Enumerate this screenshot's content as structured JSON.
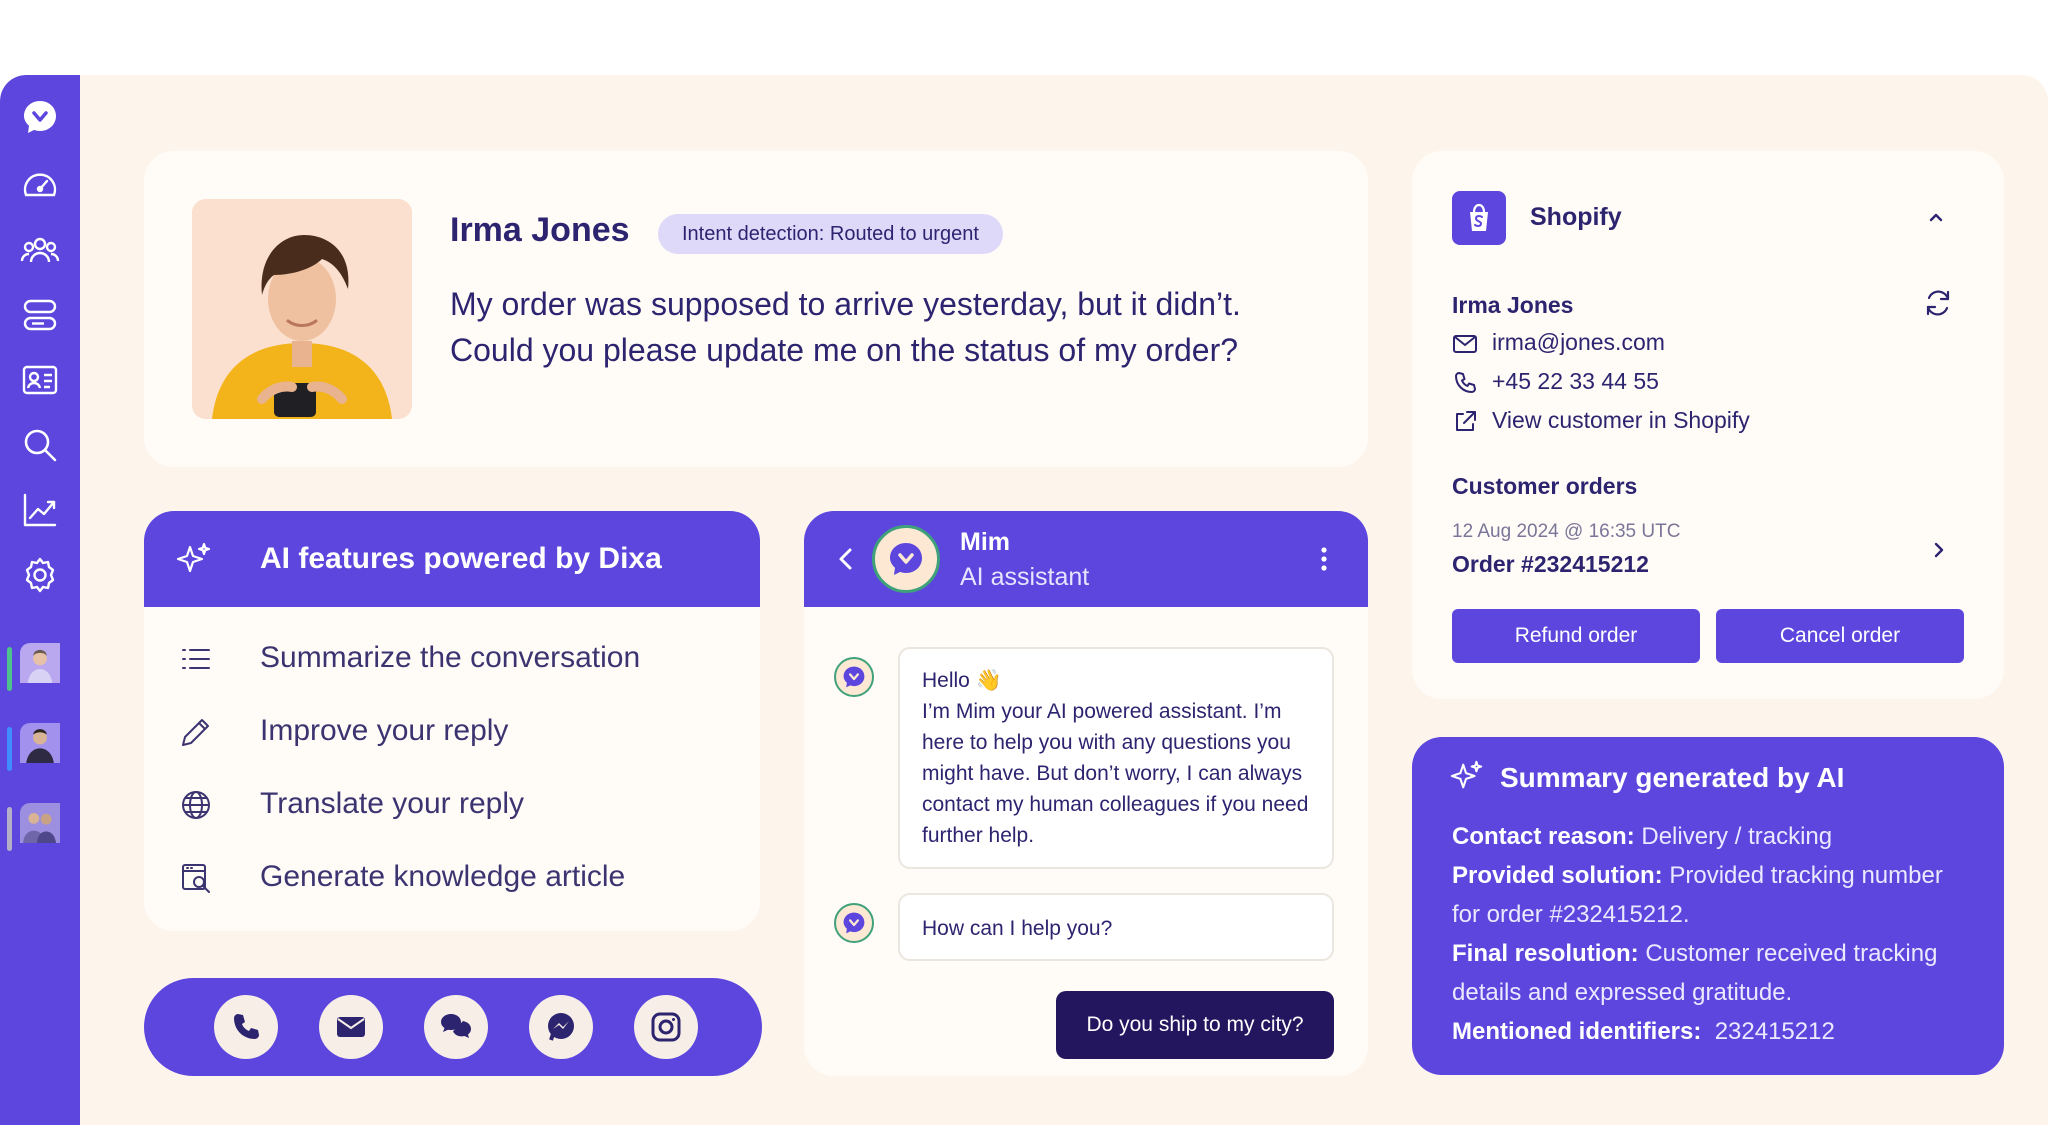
{
  "colors": {
    "brand": "#5c46de",
    "background": "#fdf5ec",
    "text": "#2d2470",
    "dark_button": "#23165e"
  },
  "sidebar": {
    "icons": [
      "dixa-logo-icon",
      "dashboard-gauge-icon",
      "team-icon",
      "queues-icon",
      "contact-card-icon",
      "search-icon",
      "analytics-icon",
      "settings-icon"
    ],
    "agents": [
      "agent-avatar-1",
      "agent-avatar-2",
      "agent-avatar-3"
    ]
  },
  "conversation": {
    "customer_name": "Irma Jones",
    "intent_badge": "Intent detection: Routed to urgent",
    "message_line1": "My order was supposed to arrive yesterday, but it didn’t.",
    "message_line2": "Could you please update me on the status of my order?"
  },
  "ai_features": {
    "title": "AI features powered by Dixa",
    "items": [
      {
        "label": "Summarize the conversation",
        "icon": "list-icon"
      },
      {
        "label": "Improve your reply",
        "icon": "pencil-icon"
      },
      {
        "label": "Translate your reply",
        "icon": "globe-icon"
      },
      {
        "label": "Generate knowledge article",
        "icon": "knowledge-search-icon"
      }
    ]
  },
  "channels": [
    "phone-icon",
    "email-icon",
    "chat-icon",
    "messenger-icon",
    "instagram-icon"
  ],
  "chat": {
    "bot_name": "Mim",
    "bot_role": "AI assistant",
    "greeting": "Hello 👋",
    "intro": "I’m Mim your AI powered assistant. I’m here to help you with any questions you might have. But don’t worry, I can always contact my human colleagues if you need further help.",
    "prompt": "How can I help you?",
    "user_message": "Do you ship to my city?"
  },
  "shopify": {
    "title": "Shopify",
    "customer_name": "Irma Jones",
    "email": "irma@jones.com",
    "phone": "+45 22 33 44 55",
    "view_link": "View customer in Shopify",
    "orders_heading": "Customer orders",
    "order_date": "12 Aug 2024 @ 16:35 UTC",
    "order_number": "Order #232415212",
    "refund_label": "Refund order",
    "cancel_label": "Cancel order"
  },
  "summary": {
    "title": "Summary generated by AI",
    "contact_reason_label": "Contact reason:",
    "contact_reason": "Delivery / tracking",
    "provided_solution_label": "Provided solution:",
    "provided_solution": "Provided tracking number for order #232415212.",
    "final_resolution_label": "Final resolution:",
    "final_resolution": "Customer received tracking details and expressed gratitude.",
    "identifiers_label": "Mentioned identifiers:",
    "identifiers": "232415212"
  }
}
